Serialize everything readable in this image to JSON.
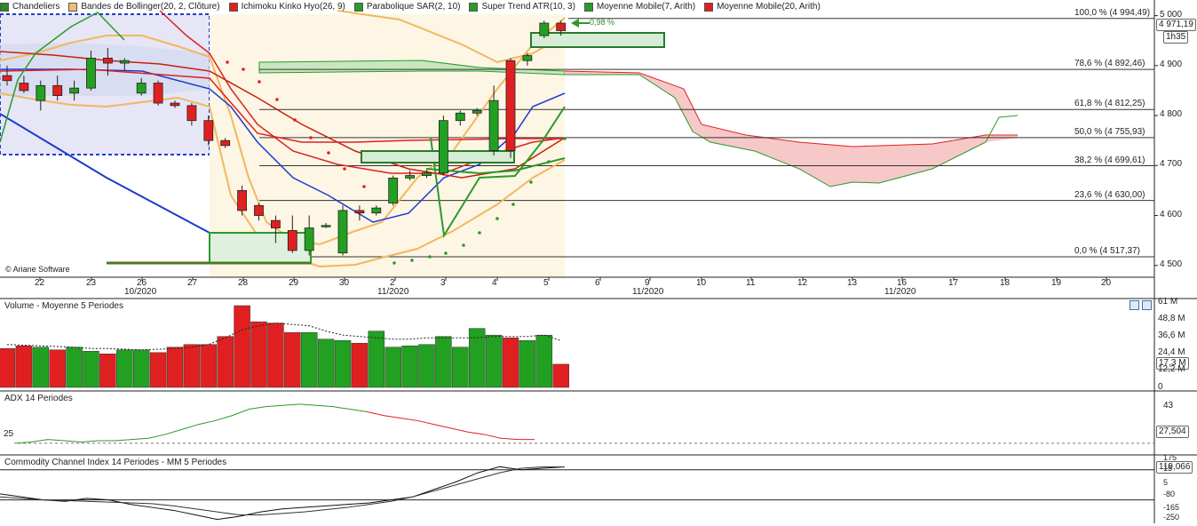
{
  "legend": [
    {
      "label": "Chandeliers",
      "color": "#2a8a2a"
    },
    {
      "label": "Bandes de Bollinger(20, 2, Clôture)",
      "color": "#f0c070"
    },
    {
      "label": "Ichimoku Kinko Hyo(26, 9)",
      "color": "#e02020"
    },
    {
      "label": "Parabolique SAR(2, 10)",
      "color": "#2a9a2a"
    },
    {
      "label": "Super Trend ATR(10, 3)",
      "color": "#2a9a2a"
    },
    {
      "label": "Moyenne Mobile(7, Arith)",
      "color": "#2a9a2a"
    },
    {
      "label": "Moyenne Mobile(20, Arith)",
      "color": "#e02020"
    }
  ],
  "price_axis": {
    "labels": [
      "5 000",
      "4 900",
      "4 800",
      "4 700",
      "4 600",
      "4 500"
    ],
    "current_price": "4 971,19",
    "timeframe": "1h35"
  },
  "fibonacci": [
    {
      "label": "100,0 % (4 994,49)",
      "value": 4994.49
    },
    {
      "label": "78,6 % (4 892,46)",
      "value": 4892.46
    },
    {
      "label": "61,8 % (4 812,25)",
      "value": 4812.25
    },
    {
      "label": "50,0 % (4 755,93)",
      "value": 4755.93
    },
    {
      "label": "38,2 % (4 699,61)",
      "value": 4699.61
    },
    {
      "label": "23,6 % (4 630,00)",
      "value": 4630.0
    },
    {
      "label": "0,0 % (4 517,37)",
      "value": 4517.37
    }
  ],
  "annotation": "0,98 %",
  "copyright": "© Ariane Software",
  "x_axis": {
    "days": [
      "22",
      "23",
      "26",
      "27",
      "28",
      "29",
      "30",
      "2",
      "3",
      "4",
      "5",
      "6",
      "9",
      "10",
      "11",
      "12",
      "13",
      "16",
      "17",
      "18",
      "19",
      "20"
    ],
    "months": [
      {
        "label": "10/2020",
        "under": "26"
      },
      {
        "label": "11/2020",
        "under": "2"
      },
      {
        "label": "11/2020",
        "under": "9"
      },
      {
        "label": "11/2020",
        "under": "16"
      }
    ]
  },
  "volume_panel": {
    "title": "Volume  - Moyenne 5 Periodes",
    "axis": [
      "61 M",
      "48,8 M",
      "36,6 M",
      "24,4 M",
      "12,2 M",
      "0"
    ],
    "current": "17,3 M"
  },
  "adx_panel": {
    "title": "ADX 14 Periodes",
    "axis": [
      "43",
      "25"
    ],
    "current": "27,504"
  },
  "cci_panel": {
    "title": "Commodity Channel Index 14 Periodes - MM  5 Periodes",
    "axis": [
      "175",
      "15",
      "5",
      "-80",
      "-165",
      "-250"
    ],
    "current": "119,066"
  },
  "chart_data": {
    "type": "candlestick",
    "y_range": [
      4480,
      5010
    ],
    "candles": [
      {
        "o": 4880,
        "h": 4900,
        "l": 4860,
        "c": 4870
      },
      {
        "o": 4865,
        "h": 4880,
        "l": 4845,
        "c": 4850
      },
      {
        "o": 4830,
        "h": 4870,
        "l": 4810,
        "c": 4860
      },
      {
        "o": 4860,
        "h": 4880,
        "l": 4830,
        "c": 4840
      },
      {
        "o": 4845,
        "h": 4870,
        "l": 4830,
        "c": 4855
      },
      {
        "o": 4855,
        "h": 4930,
        "l": 4850,
        "c": 4915
      },
      {
        "o": 4915,
        "h": 4935,
        "l": 4880,
        "c": 4905
      },
      {
        "o": 4905,
        "h": 4915,
        "l": 4890,
        "c": 4910
      },
      {
        "o": 4845,
        "h": 4875,
        "l": 4840,
        "c": 4865
      },
      {
        "o": 4865,
        "h": 4870,
        "l": 4820,
        "c": 4825
      },
      {
        "o": 4825,
        "h": 4830,
        "l": 4815,
        "c": 4820
      },
      {
        "o": 4820,
        "h": 4825,
        "l": 4780,
        "c": 4790
      },
      {
        "o": 4790,
        "h": 4800,
        "l": 4740,
        "c": 4750
      },
      {
        "o": 4750,
        "h": 4755,
        "l": 4735,
        "c": 4740
      },
      {
        "o": 4650,
        "h": 4660,
        "l": 4600,
        "c": 4610
      },
      {
        "o": 4620,
        "h": 4625,
        "l": 4590,
        "c": 4600
      },
      {
        "o": 4590,
        "h": 4600,
        "l": 4545,
        "c": 4575
      },
      {
        "o": 4570,
        "h": 4600,
        "l": 4525,
        "c": 4530
      },
      {
        "o": 4530,
        "h": 4600,
        "l": 4520,
        "c": 4575
      },
      {
        "o": 4580,
        "h": 4585,
        "l": 4575,
        "c": 4580
      },
      {
        "o": 4525,
        "h": 4620,
        "l": 4520,
        "c": 4610
      },
      {
        "o": 4610,
        "h": 4620,
        "l": 4590,
        "c": 4605
      },
      {
        "o": 4605,
        "h": 4620,
        "l": 4600,
        "c": 4615
      },
      {
        "o": 4625,
        "h": 4680,
        "l": 4620,
        "c": 4675
      },
      {
        "o": 4675,
        "h": 4690,
        "l": 4670,
        "c": 4680
      },
      {
        "o": 4680,
        "h": 4690,
        "l": 4675,
        "c": 4685
      },
      {
        "o": 4685,
        "h": 4800,
        "l": 4680,
        "c": 4790
      },
      {
        "o": 4790,
        "h": 4810,
        "l": 4780,
        "c": 4805
      },
      {
        "o": 4805,
        "h": 4815,
        "l": 4800,
        "c": 4810
      },
      {
        "o": 4730,
        "h": 4860,
        "l": 4720,
        "c": 4830
      },
      {
        "o": 4910,
        "h": 4915,
        "l": 4715,
        "c": 4730
      },
      {
        "o": 4910,
        "h": 4925,
        "l": 4900,
        "c": 4920
      },
      {
        "o": 4960,
        "h": 4990,
        "l": 4955,
        "c": 4985
      },
      {
        "o": 4985,
        "h": 4990,
        "l": 4960,
        "c": 4970
      }
    ],
    "volume": [
      29,
      31,
      30,
      28,
      30,
      27,
      25,
      28,
      28,
      26,
      30,
      32,
      32,
      38,
      61,
      49,
      48,
      41,
      41,
      36,
      35,
      33,
      42,
      30,
      31,
      32,
      38,
      30,
      44,
      39,
      37,
      35,
      39,
      17.3
    ],
    "volume_avg": [
      32,
      31.5,
      31,
      30.5,
      30,
      29,
      29,
      28.5,
      28,
      28.5,
      29,
      30,
      32,
      37,
      43,
      46,
      48,
      47,
      46,
      42,
      39,
      38,
      37,
      36,
      36,
      37,
      37,
      37,
      37,
      38,
      38,
      38,
      39,
      35
    ],
    "adx": [
      25,
      26,
      28,
      27,
      26,
      27,
      27,
      28,
      29,
      32,
      36,
      40,
      43,
      47,
      52,
      54,
      55,
      56,
      55,
      54,
      52,
      50,
      47,
      45,
      43,
      40,
      37,
      34,
      32,
      29,
      28,
      28
    ],
    "cci": [
      -60,
      -80,
      -100,
      -110,
      -90,
      -100,
      -130,
      -150,
      -170,
      -200,
      -230,
      -210,
      -180,
      -160,
      -150,
      -140,
      -130,
      -120,
      -100,
      -80,
      -30,
      20,
      80,
      120,
      100,
      110,
      119
    ],
    "cci_ma": [
      -80,
      -90,
      -100,
      -105,
      -110,
      -115,
      -120,
      -125,
      -140,
      -160,
      -180,
      -200,
      -200,
      -190,
      -180,
      -165,
      -150,
      -130,
      -110,
      -80,
      -40,
      0,
      40,
      80,
      110,
      119,
      119
    ]
  }
}
